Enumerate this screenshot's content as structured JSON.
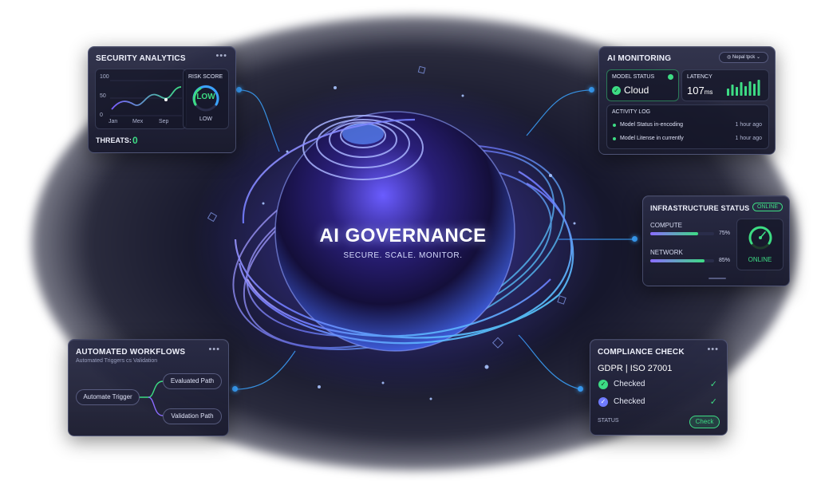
{
  "hero": {
    "title": "AI GOVERNANCE",
    "subtitle": "SECURE. SCALE. MONITOR."
  },
  "security_analytics": {
    "title": "SECURITY ANALYTICS",
    "chart": {
      "y_ticks": [
        "100",
        "50",
        "0"
      ],
      "x_ticks": [
        "Jan",
        "Mex",
        "Sep"
      ]
    },
    "risk_score": {
      "label": "RISK SCORE",
      "value": "LOW",
      "caption": "LOW"
    },
    "threats_label": "THREATS:",
    "threats_value": "0"
  },
  "ai_monitoring": {
    "title": "AI MONITORING",
    "dropdown": "Nepal tpck",
    "model_status": {
      "label": "MODEL STATUS",
      "value": "Cloud"
    },
    "latency": {
      "label": "LATENCY",
      "value": "107",
      "unit": "ms",
      "bars": [
        0.45,
        0.7,
        0.55,
        0.85,
        0.6,
        0.9,
        0.75,
        1.0
      ]
    },
    "activity_log": {
      "title": "ACTIVITY LOG",
      "entries": [
        {
          "text": "Model Status in-encoding",
          "time": "1 hour ago"
        },
        {
          "text": "Model Litense in currently",
          "time": "1 hour ago"
        }
      ]
    }
  },
  "infrastructure": {
    "title": "INFRASTRUCTURE STATUS",
    "badge": "ONLINE",
    "compute": {
      "label": "COMPUTE",
      "value": "75%",
      "fraction": 0.75
    },
    "network": {
      "label": "NETWORK",
      "value": "85%",
      "fraction": 0.85
    },
    "gauge_label": "ONLINE"
  },
  "workflows": {
    "title": "AUTOMATED WORKFLOWS",
    "subtitle": "Automated Triggers cs Validation",
    "trigger": "Automate Trigger",
    "path_a": "Evaluated Path",
    "path_b": "Validation Path"
  },
  "compliance": {
    "title": "COMPLIANCE CHECK",
    "standards": "GDPR | ISO 27001",
    "items": [
      "Checked",
      "Checked"
    ],
    "status_label": "STATUS",
    "status_button": "Check"
  },
  "colors": {
    "accent_blue": "#3ba3ff",
    "accent_green": "#3ddc84",
    "accent_purple": "#8b6cff"
  }
}
